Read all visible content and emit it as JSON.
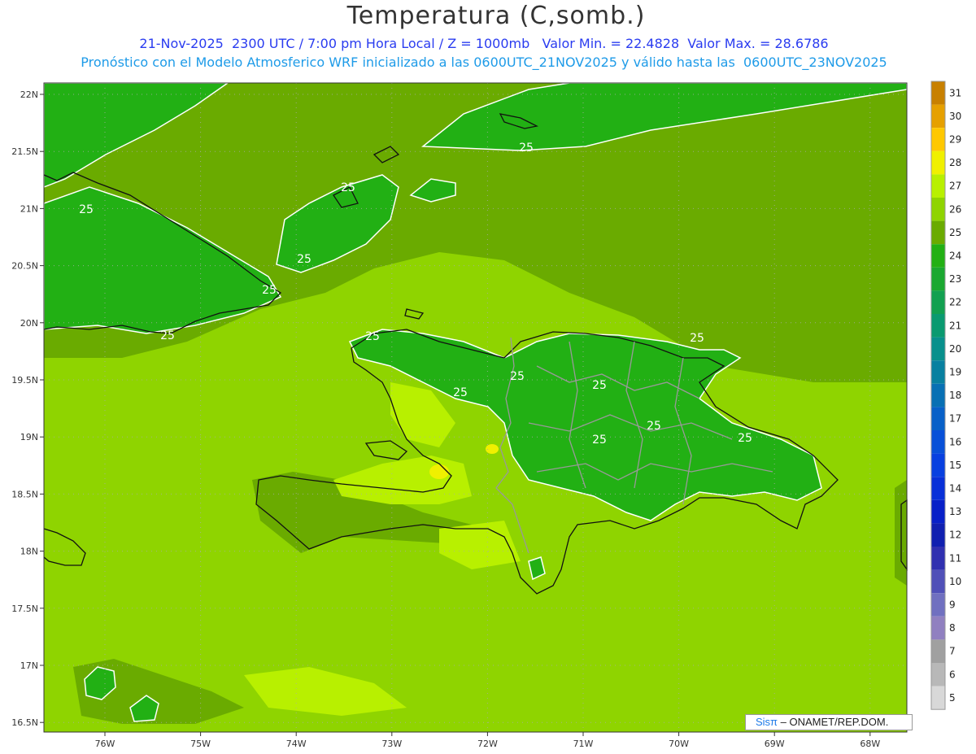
{
  "header": {
    "title": "Temperatura (C,somb.)",
    "line1": "21-Nov-2025  2300 UTC / 7:00 pm Hora Local / Z = 1000mb   Valor Min. = 22.4828  Valor Max. = 28.6786",
    "line2": "Pronóstico con el Modelo Atmosferico WRF inicializado a las 0600UTC_21NOV2025 y válido hasta las  0600UTC_23NOV2025"
  },
  "map": {
    "lat_labels": [
      "22N",
      "21.5N",
      "21N",
      "20.5N",
      "20N",
      "19.5N",
      "19N",
      "18.5N",
      "18N",
      "17.5N",
      "17N",
      "16.5N"
    ],
    "lon_labels": [
      "76W",
      "75W",
      "74W",
      "73W",
      "72W",
      "71W",
      "70W",
      "69W",
      "68W"
    ],
    "contour_labels": [
      "25",
      "25",
      "25",
      "25",
      "25",
      "25",
      "25",
      "25",
      "25",
      "25",
      "25",
      "25",
      "25",
      "25"
    ],
    "colors": {
      "background_field": "#8fd400",
      "cooler_field": "#6aab00",
      "cool_24": "#22b014",
      "warm_27": "#b8f000",
      "warm_28": "#f0f000"
    }
  },
  "colorbar": {
    "levels": [
      "31",
      "30",
      "29",
      "28",
      "27",
      "26",
      "25",
      "24",
      "23",
      "22",
      "21",
      "20",
      "19",
      "18",
      "17",
      "16",
      "15",
      "14",
      "13",
      "12",
      "11",
      "10",
      "9",
      "8",
      "7",
      "6",
      "5"
    ],
    "colors": [
      "#c88000",
      "#e6a000",
      "#ffc800",
      "#f0f000",
      "#b8f000",
      "#8fd400",
      "#6aab00",
      "#22b014",
      "#1aa830",
      "#12a050",
      "#0a9a70",
      "#08908c",
      "#0880a0",
      "#0870b4",
      "#0860c8",
      "#0850d8",
      "#0840e0",
      "#0830d8",
      "#0820c8",
      "#1020b0",
      "#3030b0",
      "#5050b8",
      "#7070c0",
      "#9080c0",
      "#a0a0a0",
      "#b8b8b8",
      "#d8d8d8"
    ]
  },
  "credit": {
    "sis": "Sisπ",
    "org": " – ONAMET/REP.DOM."
  }
}
